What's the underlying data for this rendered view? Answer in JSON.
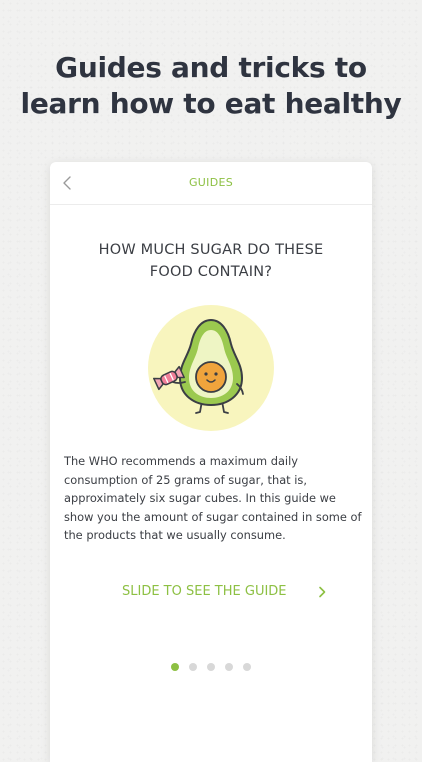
{
  "headline": {
    "line1": "Guides and tricks to",
    "line2": "learn how to eat healthy"
  },
  "nav": {
    "title": "GUIDES",
    "back_icon": "chevron-left-icon"
  },
  "guide": {
    "title_line1": "HOW MUCH SUGAR DO THESE",
    "title_line2": "FOOD CONTAIN?",
    "illustration": "avocado-holding-candy-illustration",
    "body_lines": [
      "The WHO recommends a maximum daily",
      "consumption of 25 grams of sugar, that is,",
      "approximately six sugar cubes. In this guide we",
      "show you the amount of sugar contained in some of",
      "the products that we usually consume."
    ]
  },
  "cta": {
    "label": "SLIDE TO SEE THE GUIDE",
    "icon": "chevron-right-icon"
  },
  "pagination": {
    "total": 5,
    "active_index": 0
  },
  "colors": {
    "accent": "#8dc043",
    "text_dark": "#2f3440",
    "dot_inactive": "#d8d8d8",
    "illustration_bg": "#f8f5be"
  }
}
